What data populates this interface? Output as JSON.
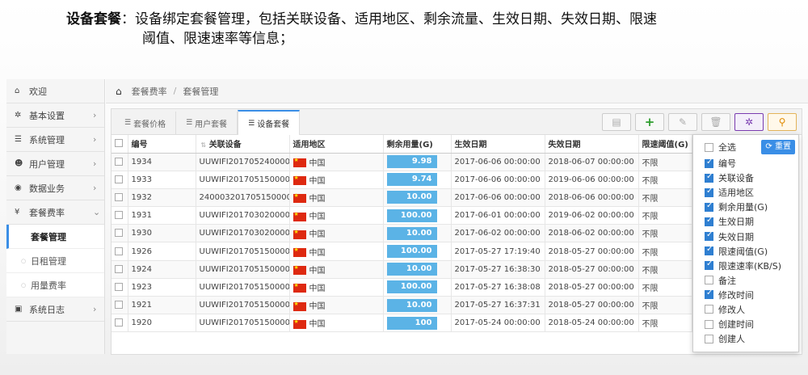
{
  "caption": {
    "term": "设备套餐",
    "line1": "：设备绑定套餐管理，包括关联设备、适用地区、剩余流量、生效日期、失效日期、限速",
    "line2": "阈值、限速速率等信息；"
  },
  "sidebar": {
    "items": [
      {
        "icon": "home-icon",
        "glyph": "⌂",
        "label": "欢迎",
        "arrow": ""
      },
      {
        "icon": "gear-icon",
        "glyph": "✲",
        "label": "基本设置",
        "arrow": "›"
      },
      {
        "icon": "list-icon",
        "glyph": "☰",
        "label": "系统管理",
        "arrow": "›"
      },
      {
        "icon": "users-icon",
        "glyph": "☻",
        "label": "用户管理",
        "arrow": "›"
      },
      {
        "icon": "rss-icon",
        "glyph": "◉",
        "label": "数据业务",
        "arrow": "›"
      },
      {
        "icon": "yen-icon",
        "glyph": "¥",
        "label": "套餐费率",
        "arrow": "⌄"
      }
    ],
    "subitems": [
      {
        "label": "套餐管理"
      },
      {
        "label": "日租管理"
      },
      {
        "label": "用量费率"
      }
    ],
    "last_item": {
      "icon": "log-icon",
      "glyph": "▣",
      "label": "系统日志",
      "arrow": "›"
    }
  },
  "breadcrumb": {
    "items": [
      "套餐费率",
      "套餐管理"
    ],
    "sep": "/"
  },
  "tabs": [
    {
      "label": "套餐价格",
      "active": false
    },
    {
      "label": "用户套餐",
      "active": false
    },
    {
      "label": "设备套餐",
      "active": true
    }
  ],
  "toolbar": {
    "buttons": [
      {
        "name": "columns-toggle-button",
        "glyph": "▤",
        "cls": "mute"
      },
      {
        "name": "add-button",
        "glyph": "+",
        "cls": "plus"
      },
      {
        "name": "edit-button",
        "glyph": "✎",
        "cls": "mute"
      },
      {
        "name": "delete-button",
        "glyph": "🗑",
        "cls": "mute"
      },
      {
        "name": "settings-button",
        "glyph": "✲",
        "cls": "gear"
      },
      {
        "name": "search-button",
        "glyph": "⚲",
        "cls": "zoom"
      }
    ]
  },
  "table": {
    "headers": [
      "编号",
      "关联设备",
      "适用地区",
      "剩余用量(G)",
      "生效日期",
      "失效日期",
      "限速阈值(G)"
    ],
    "rows": [
      {
        "id": "1934",
        "device": "UUWIFI201705240000...",
        "region": "中国",
        "remaining": "9.98",
        "fill": 1.0,
        "start": "2017-06-06 00:00:00",
        "end": "2018-06-07 00:00:00",
        "limit": "不限"
      },
      {
        "id": "1933",
        "device": "UUWIFI201705150000...",
        "region": "中国",
        "remaining": "9.74",
        "fill": 1.0,
        "start": "2017-06-06 00:00:00",
        "end": "2019-06-06 00:00:00",
        "limit": "不限"
      },
      {
        "id": "1932",
        "device": "2400032017051500001...",
        "region": "中国",
        "remaining": "10.00",
        "fill": 1.0,
        "start": "2017-06-06 00:00:00",
        "end": "2018-06-06 00:00:00",
        "limit": "不限"
      },
      {
        "id": "1931",
        "device": "UUWIFI201703020000...",
        "region": "中国",
        "remaining": "100.00",
        "fill": 1.0,
        "start": "2017-06-01 00:00:00",
        "end": "2019-06-02 00:00:00",
        "limit": "不限"
      },
      {
        "id": "1930",
        "device": "UUWIFI201703020000...",
        "region": "中国",
        "remaining": "10.00",
        "fill": 1.0,
        "start": "2017-06-02 00:00:00",
        "end": "2018-06-02 00:00:00",
        "limit": "不限"
      },
      {
        "id": "1926",
        "device": "UUWIFI201705150000...",
        "region": "中国",
        "remaining": "100.00",
        "fill": 1.0,
        "start": "2017-05-27 17:19:40",
        "end": "2018-05-27 00:00:00",
        "limit": "不限"
      },
      {
        "id": "1924",
        "device": "UUWIFI201705150000...",
        "region": "中国",
        "remaining": "10.00",
        "fill": 1.0,
        "start": "2017-05-27 16:38:30",
        "end": "2018-05-27 00:00:00",
        "limit": "不限"
      },
      {
        "id": "1923",
        "device": "UUWIFI201705150000...",
        "region": "中国",
        "remaining": "100.00",
        "fill": 1.0,
        "start": "2017-05-27 16:38:08",
        "end": "2018-05-27 00:00:00",
        "limit": "不限"
      },
      {
        "id": "1921",
        "device": "UUWIFI201705150000...",
        "region": "中国",
        "remaining": "10.00",
        "fill": 1.0,
        "start": "2017-05-27 16:37:31",
        "end": "2018-05-27 00:00:00",
        "limit": "不限"
      },
      {
        "id": "1920",
        "device": "UUWIFI201705150000...",
        "region": "中国",
        "remaining": "100",
        "fill": 1.0,
        "start": "2017-05-24 00:00:00",
        "end": "2018-05-24 00:00:00",
        "limit": "不限"
      }
    ]
  },
  "column_menu": {
    "select_all_label": "全选",
    "reset_label": "重置",
    "reset_icon": "refresh-icon",
    "items": [
      {
        "label": "编号",
        "checked": true
      },
      {
        "label": "关联设备",
        "checked": true
      },
      {
        "label": "适用地区",
        "checked": true
      },
      {
        "label": "剩余用量(G)",
        "checked": true
      },
      {
        "label": "生效日期",
        "checked": true
      },
      {
        "label": "失效日期",
        "checked": true
      },
      {
        "label": "限速阈值(G)",
        "checked": true
      },
      {
        "label": "限速速率(KB/S)",
        "checked": true
      },
      {
        "label": "备注",
        "checked": false
      },
      {
        "label": "修改时间",
        "checked": true
      },
      {
        "label": "修改人",
        "checked": false
      },
      {
        "label": "创建时间",
        "checked": false
      },
      {
        "label": "创建人",
        "checked": false
      }
    ]
  },
  "colors": {
    "accent": "#3a8ee6",
    "bar": "#5bb3e6",
    "flag": "#de2910"
  }
}
